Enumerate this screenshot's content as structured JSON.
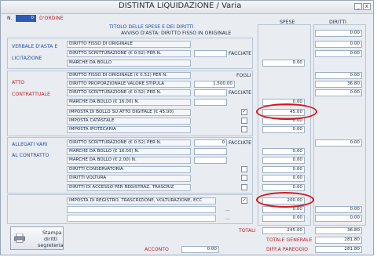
{
  "window": {
    "title": "DISTINTA LIQUIDAZIONE / Varia"
  },
  "header": {
    "n_label": "N.",
    "n_value": "0",
    "ordine_label": "D'ORDINE",
    "titolo": "TITOLO DELLE SPESE E DEI DIRITTI",
    "avviso": "AVVISO D'ASTA: DIRITTO FISSO IN ORIGINALE",
    "spese_header": "SPESE",
    "diritti_header": "DIRITTI",
    "diritti_top": "0.00"
  },
  "verbale": {
    "title_line1": "VERBALE D'ASTA E",
    "title_line2": "LICITAZIONE",
    "rows": [
      {
        "label": "DIRITTO FISSO DI ORIGINALE",
        "diritti": "0.00"
      },
      {
        "label": "DIRITTO SCRITTURAZIONE (€ 0.52) PER N.",
        "facciate": "FACCIATE",
        "diritti": "0.00"
      },
      {
        "label": "MARCHE DA BOLLO",
        "spese": "0.00"
      }
    ]
  },
  "atto": {
    "title_line1": "ATTO",
    "title_line2": "CONTRATTUALE",
    "rows": [
      {
        "label": "DIRITTO FISSO DI ORIGINALE (€ 0.52) PER N.",
        "fogli": "FOGLI",
        "diritti": "0.00"
      },
      {
        "label": "DIRITTO PROPORZIONALE VALORE STIPULA",
        "value": "1,500.00",
        "diritti": "36.80"
      },
      {
        "label": "DIRITTO SCRITTURAZIONE (€ 0.52) PER N.",
        "facciate": "FACCIATE",
        "diritti": "0.00"
      },
      {
        "label": "MARCHE DA BOLLO (€ 16.00) N.",
        "spese": "0.00"
      },
      {
        "label": "IMPOSTA DI BOLLO SU ATTO DIGITALE (€ 45.00)",
        "checked": true,
        "spese": "45.00"
      },
      {
        "label": "IMPOSTA CATASTALE",
        "checked": false,
        "spese": "0.00"
      },
      {
        "label": "IMPOSTA IPOTECARIA",
        "checked": false,
        "spese": "0.00"
      }
    ]
  },
  "allegati": {
    "title_line1": "ALLEGATI VARI",
    "title_line2": "AL CONTRATTO",
    "rows": [
      {
        "label": "DIRITTO SCRITTURAZIONE (€ 0.52) PER N.",
        "num": "0",
        "facciate": "FACCIATE",
        "diritti": "0.00"
      },
      {
        "label": "MARCHE DA BOLLO (€ 16.00) N.",
        "spese": "0.00"
      },
      {
        "label": "MARCHE DA BOLLO (€ 2.00) N.",
        "spese": "0.00"
      },
      {
        "label": "DIRITTI CONSERVATORIA",
        "checked": false,
        "spese": "0.00"
      },
      {
        "label": "DIRITTI VOLTURA",
        "checked": false,
        "spese": "0.00"
      },
      {
        "label": "DIRITTI DI ACCESSO PER REGISTRAZ. TRASCRIZ",
        "checked": false,
        "spese": "0.00"
      }
    ]
  },
  "imposta": {
    "rows": [
      {
        "label": "IMPOSTA DI REGISTRO, TRASCRIZIONE, VOLTURAZIONE, ECC",
        "checked": true,
        "spese": "200.00"
      },
      {
        "dots": "...",
        "spese": "0.00",
        "diritti": "0.00"
      },
      {
        "dots": "...",
        "spese": "0.00",
        "diritti": "0.00"
      }
    ]
  },
  "totals": {
    "totali_label": "TOTALI",
    "spese": "245.00",
    "diritti": "36.80",
    "generale_label": "TOTALE GENERALE",
    "generale": "281.80",
    "pareggio_label": "DIFF.A PAREGGIO",
    "pareggio": "281.80",
    "acconto_label": "ACCONTO",
    "acconto": "0.00"
  },
  "print_button": {
    "line1": "Stampa",
    "line2": "diritti",
    "line3": "segreteria"
  },
  "colors": {
    "annotation": "#d0191e",
    "section_title": "#1f4fa8",
    "red_label": "#c0202a"
  }
}
